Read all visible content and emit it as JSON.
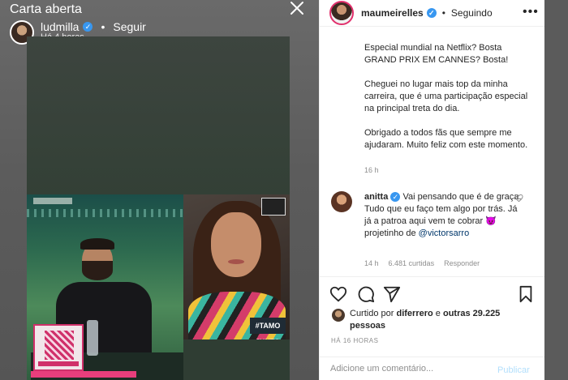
{
  "overlay": {
    "title": "Carta aberta",
    "story_username": "ludmilla",
    "story_follow": "Seguir",
    "story_time": "Há 4 horas",
    "cam_tag": "#TAMO JUNTO"
  },
  "post": {
    "username": "maumeirelles",
    "following": "Seguindo",
    "more": "•••",
    "caption": [
      "Especial mundial na Netflix? Bosta GRAND PRIX EM CANNES? Bosta!",
      "Cheguei no lugar mais top da minha carreira, que é uma participação especial na principal treta do dia.",
      "Obrigado a todos fãs que sempre me ajudaram. Muito feliz com este momento."
    ],
    "caption_time": "16 h"
  },
  "comment": {
    "username": "anitta",
    "text": "Vai pensando que é de graça. Tudo que eu faço tem algo por trás. Já já a patroa aqui vem te cobrar 😈 projetinho de",
    "mention": "@victorsarro",
    "time": "14 h",
    "likes": "6.481 curtidas",
    "reply": "Responder"
  },
  "likes": {
    "prefix": "Curtido por",
    "user": "diferrero",
    "and": "e",
    "others": "outras 29.225 pessoas"
  },
  "post_date": "HÁ 16 HORAS",
  "comment_box": {
    "placeholder": "Adicione um comentário...",
    "publish": "Publicar"
  },
  "colors": {
    "verified": "#3897f0",
    "mention": "#00376b",
    "publish_disabled": "#b2dffc",
    "story_ring": "#e1306c"
  }
}
